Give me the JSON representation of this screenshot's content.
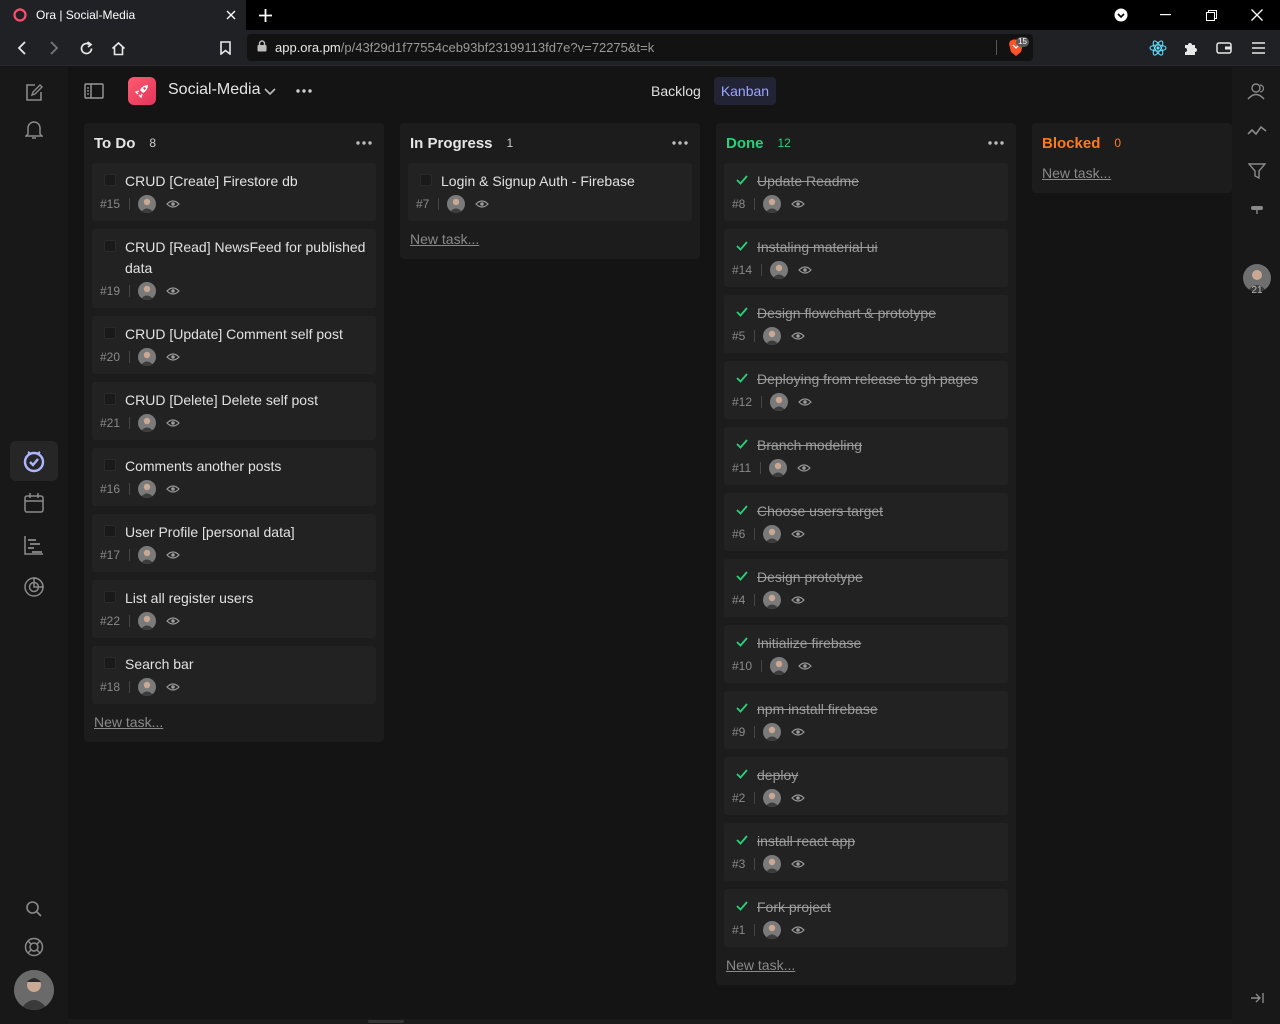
{
  "browser": {
    "tab_title": "Ora | Social-Media",
    "url_host": "app.ora.pm",
    "url_path": "/p/43f29d1f77554ceb93bf23199113fd7e?v=72275&t=k",
    "brave_badge": "15"
  },
  "project": {
    "name": "Social-Media"
  },
  "views": [
    {
      "label": "Backlog",
      "active": false
    },
    {
      "label": "Kanban",
      "active": true
    }
  ],
  "new_task_label": "New task...",
  "right_rail": {
    "member_count": "21"
  },
  "colors": {
    "todo": "#e6e6e6",
    "in_progress": "#e6e6e6",
    "done": "#29d07a",
    "blocked": "#ff7a1a",
    "accent": "#9aa6ff"
  },
  "columns": [
    {
      "title": "To Do",
      "count": "8",
      "cards": [
        {
          "title": "CRUD [Create] Firestore db",
          "id": "#15"
        },
        {
          "title": "CRUD [Read] NewsFeed for published data",
          "id": "#19"
        },
        {
          "title": "CRUD [Update] Comment self post",
          "id": "#20"
        },
        {
          "title": "CRUD [Delete] Delete self post",
          "id": "#21"
        },
        {
          "title": "Comments another posts",
          "id": "#16"
        },
        {
          "title": "User Profile [personal data]",
          "id": "#17"
        },
        {
          "title": "List all register users",
          "id": "#22"
        },
        {
          "title": "Search bar",
          "id": "#18"
        }
      ]
    },
    {
      "title": "In Progress",
      "count": "1",
      "cards": [
        {
          "title": "Login & Signup Auth - Firebase",
          "id": "#7"
        }
      ]
    },
    {
      "title": "Done",
      "count": "12",
      "cards": [
        {
          "title": "Update Readme",
          "id": "#8"
        },
        {
          "title": "Instaling material ui",
          "id": "#14"
        },
        {
          "title": "Design flowchart & prototype",
          "id": "#5"
        },
        {
          "title": "Deploying from release to gh pages",
          "id": "#12"
        },
        {
          "title": "Branch modeling",
          "id": "#11"
        },
        {
          "title": "Choose users target",
          "id": "#6"
        },
        {
          "title": "Design prototype",
          "id": "#4"
        },
        {
          "title": "Initialize firebase",
          "id": "#10"
        },
        {
          "title": "npm install firebase",
          "id": "#9"
        },
        {
          "title": "deploy",
          "id": "#2"
        },
        {
          "title": "install react app",
          "id": "#3"
        },
        {
          "title": "Fork project",
          "id": "#1"
        }
      ]
    },
    {
      "title": "Blocked",
      "count": "0",
      "cards": []
    }
  ]
}
